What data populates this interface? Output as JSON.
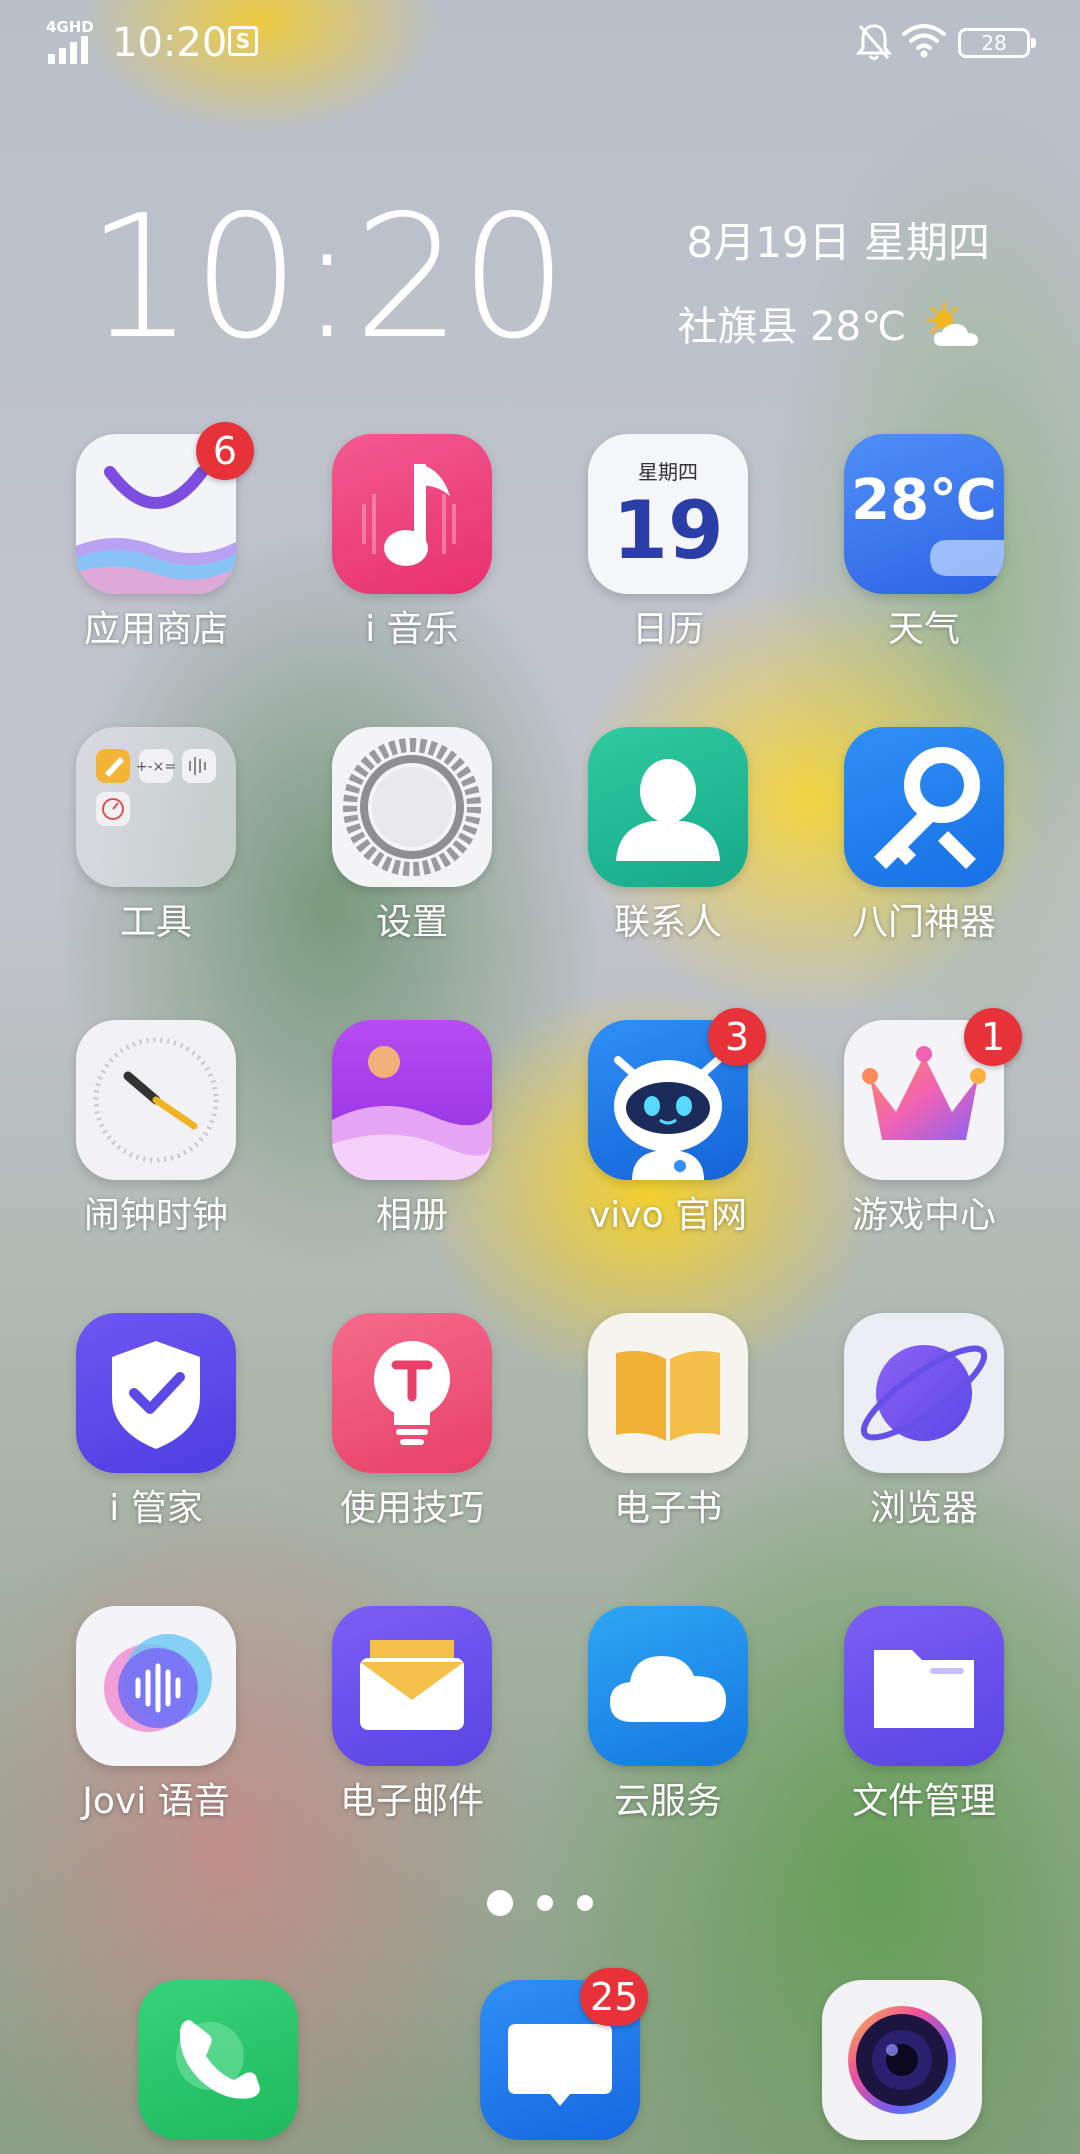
{
  "status_bar": {
    "network": "4GHD",
    "time": "10:20",
    "battery": "28"
  },
  "widget": {
    "clock": "10:20",
    "date": "8月19日 星期四",
    "weather": "社旗县 28℃"
  },
  "apps": [
    {
      "label": "应用商店",
      "badge": "6",
      "icon": "app-store-icon"
    },
    {
      "label": "i 音乐",
      "icon": "music-icon"
    },
    {
      "label": "日历",
      "icon": "calendar-icon",
      "weekday": "星期四",
      "day": "19"
    },
    {
      "label": "天气",
      "icon": "weather-icon",
      "temp": "28℃"
    },
    {
      "label": "工具",
      "icon": "tools-folder-icon"
    },
    {
      "label": "设置",
      "icon": "settings-gear-icon"
    },
    {
      "label": "联系人",
      "icon": "contacts-icon"
    },
    {
      "label": "八门神器",
      "icon": "key-wrench-icon"
    },
    {
      "label": "闹钟时钟",
      "icon": "clock-icon"
    },
    {
      "label": "相册",
      "icon": "gallery-icon"
    },
    {
      "label": "vivo 官网",
      "badge": "3",
      "icon": "vivo-robot-icon"
    },
    {
      "label": "游戏中心",
      "badge": "1",
      "icon": "crown-icon"
    },
    {
      "label": "i 管家",
      "icon": "shield-check-icon"
    },
    {
      "label": "使用技巧",
      "icon": "lightbulb-icon"
    },
    {
      "label": "电子书",
      "icon": "book-icon"
    },
    {
      "label": "浏览器",
      "icon": "planet-icon"
    },
    {
      "label": "Jovi 语音",
      "icon": "voice-wave-icon"
    },
    {
      "label": "电子邮件",
      "icon": "mail-icon"
    },
    {
      "label": "云服务",
      "icon": "cloud-icon"
    },
    {
      "label": "文件管理",
      "icon": "folder-icon"
    }
  ],
  "dock": [
    {
      "name": "phone",
      "icon": "phone-icon"
    },
    {
      "name": "messages",
      "icon": "message-icon",
      "badge": "25"
    },
    {
      "name": "camera",
      "icon": "camera-icon"
    }
  ],
  "page_indicator": {
    "current": 1,
    "total": 3
  }
}
